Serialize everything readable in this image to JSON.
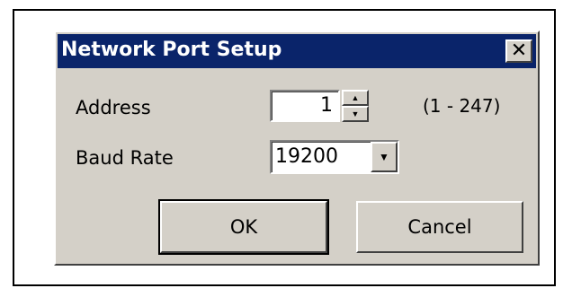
{
  "dialog": {
    "title": "Network Port Setup",
    "close_glyph": "✕",
    "address": {
      "label": "Address",
      "value": "1",
      "range": "(1 - 247)"
    },
    "baud": {
      "label": "Baud Rate",
      "value": "19200"
    },
    "buttons": {
      "ok": "OK",
      "cancel": "Cancel"
    }
  },
  "icons": {
    "close": "close-icon",
    "spin_up": "spin-up-icon",
    "spin_down": "spin-down-icon",
    "dropdown": "chevron-down-icon"
  },
  "colors": {
    "titlebar": "#0a246a",
    "dialog_face": "#d4d0c8"
  }
}
